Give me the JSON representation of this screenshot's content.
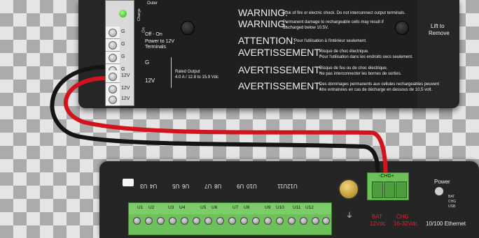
{
  "top_unit": {
    "header_cut": "Outer",
    "charge_label": "Charge",
    "switch_on": "On",
    "switch_labels": "Off - On",
    "power_to_12v": "Power to 12V",
    "terminals": "Terminals",
    "g_label": "G",
    "v12_label": "12V",
    "rated_output": "Rated Output",
    "rated_spec": "4.0 A / 12.8 to 15.9 Vdc",
    "warn1_head": "WARNING:",
    "warn1_text": "Risk of fire or electric shock. Do not interconnect output terminals.",
    "warn2_head": "WARNING:",
    "warn2_text_a": "Permanent damage to rechargeable cells may result if",
    "warn2_text_b": "discharged below 10.5V.",
    "att_head": "ATTENTION:",
    "att_text": "Pour l'utilisation à l'intérieur seulement.",
    "av1_head": "AVERTISSEMENT:",
    "av1_text_a": "Risque de choc électrique.",
    "av1_text_b": "Pour l'utilisation dans les endroits secs seulement.",
    "av2_head": "AVERTISSEMENT:",
    "av2_text_a": "Risque de feu ou de choc électrique.",
    "av2_text_b": "Ne pas interconnecter les bornes de sorties.",
    "av3_head": "AVERTISSEMENT:",
    "av3_text_a": "Des dommages permanents aux cellules rechargeables peuvent",
    "av3_text_b": "être entrainées en cas de décharge en dessous de 10,5 volt.",
    "lift_a": "Lift to",
    "lift_b": "Remove",
    "term_labels": [
      "G",
      "G",
      "G",
      "G",
      "12V",
      "12V",
      "12V"
    ]
  },
  "bottom_unit": {
    "upper_labels": [
      "U3",
      "U4",
      "U5",
      "U6",
      "U7",
      "U8",
      "U9",
      "U10",
      "U11",
      "U12"
    ],
    "lower_labels": [
      "U1",
      "U2",
      "U3",
      "U4",
      "U5",
      "U6",
      "U7",
      "U8",
      "U9",
      "U10",
      "U11",
      "U12"
    ],
    "chg_label": "-CHG+",
    "bat_label": "BAT",
    "bat_volts": "12Vdc",
    "chg_label2": "CHG",
    "chg_volts": "16-32Vdc",
    "power_label": "Power",
    "led_bat": "BAT",
    "led_chg": "CHG",
    "led_usb": "USB",
    "ethernet": "10/100 Ethernet"
  }
}
